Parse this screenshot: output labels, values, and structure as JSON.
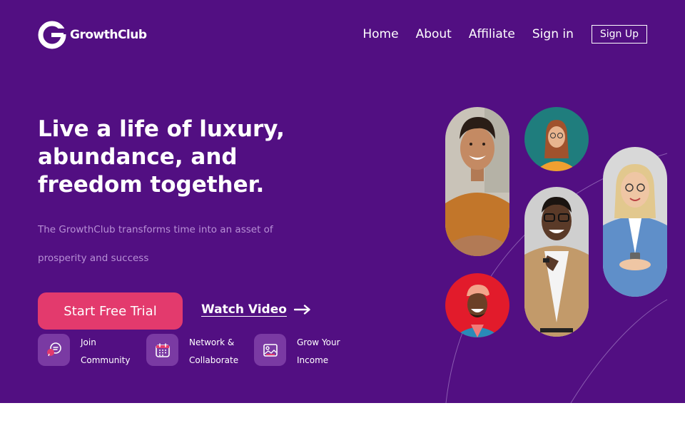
{
  "brand": {
    "name": "GrowthClub"
  },
  "nav": {
    "home": "Home",
    "about": "About",
    "affiliate": "Affiliate",
    "signin": "Sign in",
    "signup": "Sign Up"
  },
  "hero": {
    "headline_lines": [
      "Live a life of luxury,",
      "abundance, and",
      "freedom together."
    ],
    "sub_lines": [
      "The GrowthClub transforms time into an asset of",
      "prosperity and success"
    ],
    "cta": "Start Free Trial",
    "watch": "Watch Video"
  },
  "features": [
    {
      "line1": "Join",
      "line2": "Community",
      "icon": "chat-icon"
    },
    {
      "line1": "Network &",
      "line2": "Collaborate",
      "icon": "calendar-icon"
    },
    {
      "line1": "Grow Your",
      "line2": "Income",
      "icon": "image-icon"
    }
  ],
  "colors": {
    "background": "#520f82",
    "accent": "#e33a6d",
    "icon_tile": "#7a3aa3",
    "subtext": "#b890d6"
  },
  "photos": [
    {
      "icon": "smiling-man-portrait",
      "bg": "#c9c3b8"
    },
    {
      "icon": "woman-portrait",
      "bg": "#1f7d7d"
    },
    {
      "icon": "older-woman-portrait",
      "bg": "#d8d8d8"
    },
    {
      "icon": "man-with-glasses-portrait",
      "bg": "#cfcfcf"
    },
    {
      "icon": "laughing-man-portrait",
      "bg": "#e21b2b"
    }
  ]
}
